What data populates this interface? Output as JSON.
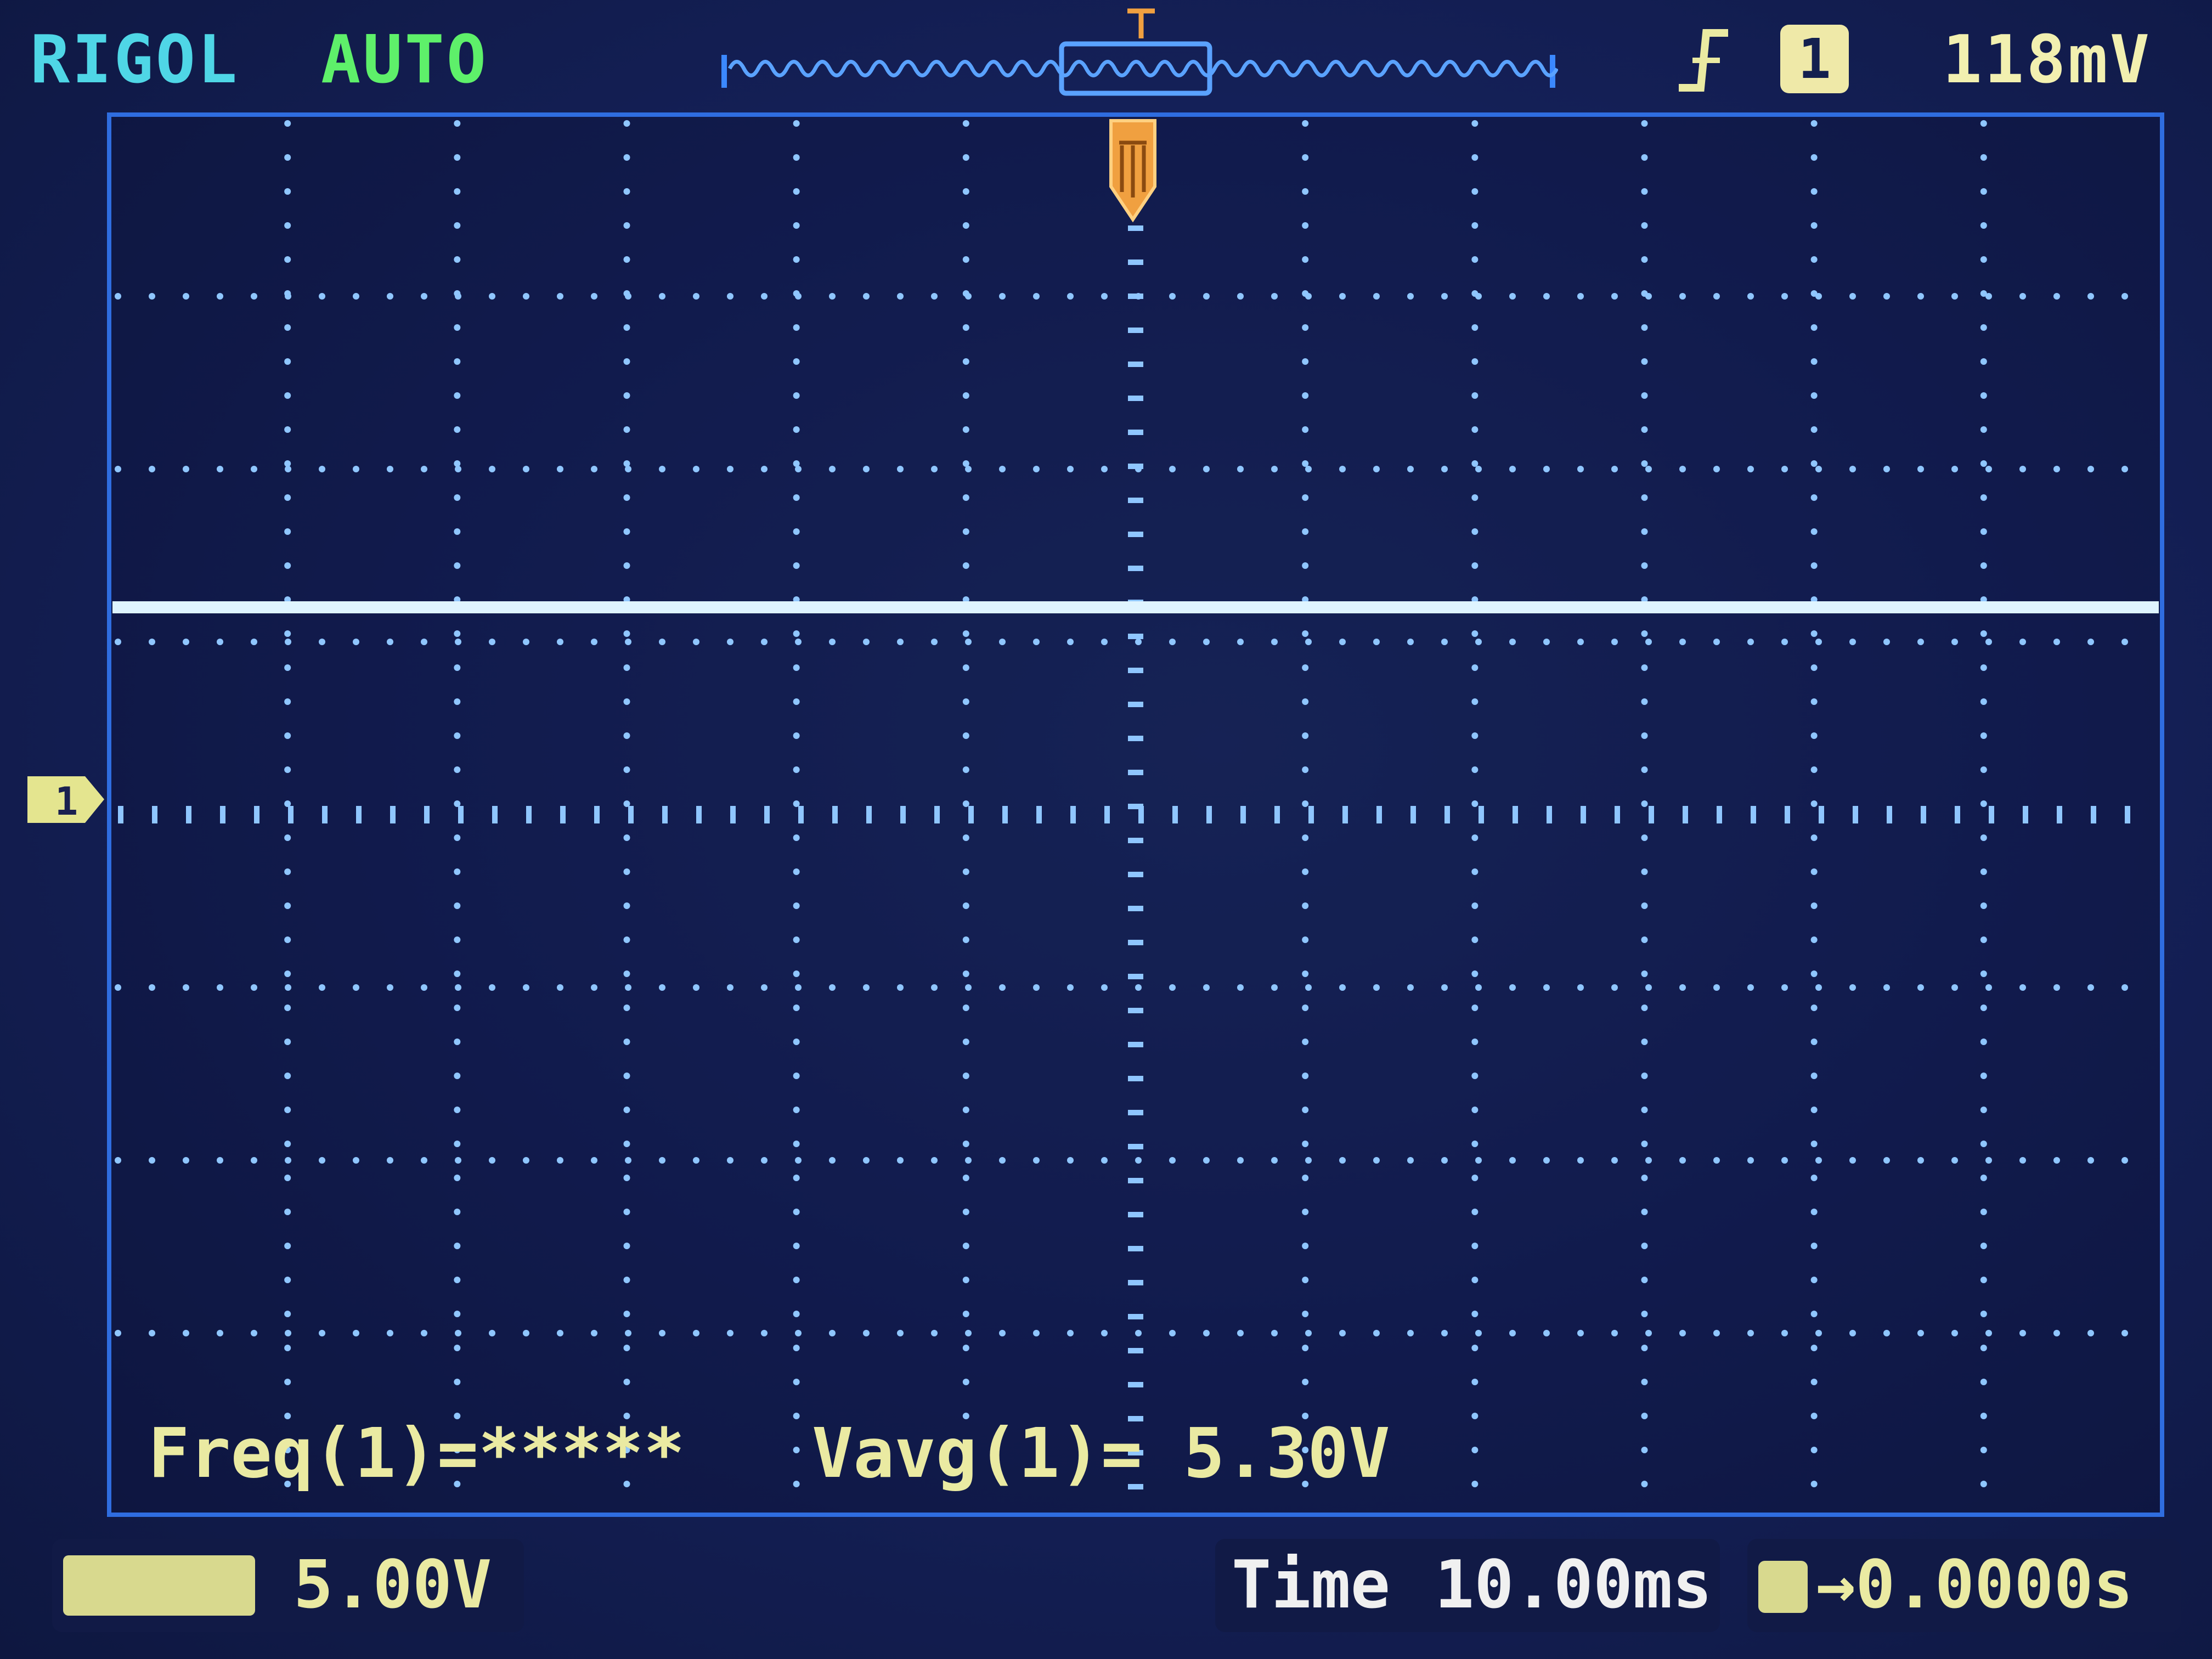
{
  "header": {
    "brand": "RIGOL",
    "mode": "AUTO",
    "trigger_source": "1",
    "trigger_level": "118mV",
    "trigger_slope_icon": "rising-edge-icon"
  },
  "waveform": {
    "channel": "1",
    "color": "#dff4ff",
    "level_divisions": 1.2
  },
  "measurements": {
    "freq": "Freq(1)=*****",
    "vavg": "Vavg(1)= 5.30V"
  },
  "footer": {
    "channel_scale": "5.00V",
    "time_label": "Time",
    "time_value": "10.00ms",
    "trigger_offset": "→0.0000s"
  },
  "colors": {
    "grid": "#8fc6ff",
    "frame": "#2f6de0",
    "text_yellow": "#eaeaa2",
    "trigger_marker": "#f0a040",
    "brand": "#4fd6e6",
    "mode": "#5ef06a"
  }
}
